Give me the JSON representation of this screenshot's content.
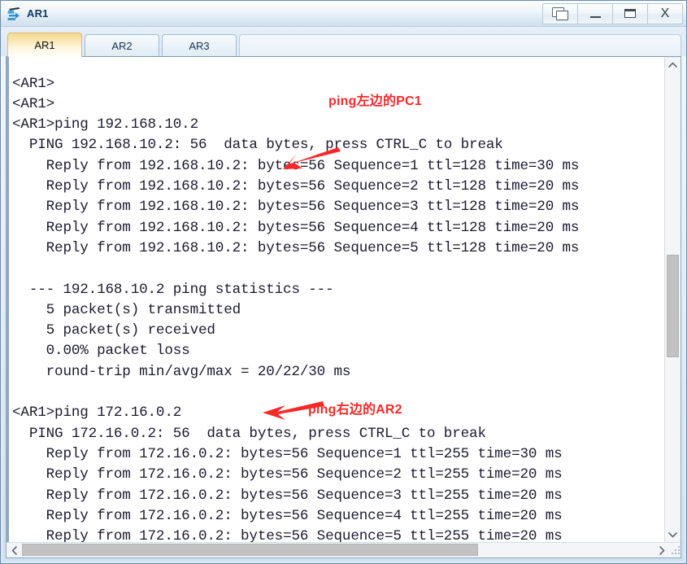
{
  "window": {
    "title": "AR1",
    "icon": "router-icon",
    "controls": [
      {
        "name": "restore-button",
        "label": "",
        "icon": "restore-windows-icon"
      },
      {
        "name": "minimize-button",
        "label": "",
        "icon": "minimize-icon"
      },
      {
        "name": "maximize-button",
        "label": "",
        "icon": "maximize-icon"
      },
      {
        "name": "close-button",
        "label": "X",
        "icon": "close-icon"
      }
    ]
  },
  "tabs": [
    {
      "label": "AR1",
      "active": true
    },
    {
      "label": "AR2",
      "active": false
    },
    {
      "label": "AR3",
      "active": false
    }
  ],
  "console": {
    "lines": [
      "<AR1>",
      "<AR1>",
      "<AR1>ping 192.168.10.2",
      "  PING 192.168.10.2: 56  data bytes, press CTRL_C to break",
      "    Reply from 192.168.10.2: bytes=56 Sequence=1 ttl=128 time=30 ms",
      "    Reply from 192.168.10.2: bytes=56 Sequence=2 ttl=128 time=20 ms",
      "    Reply from 192.168.10.2: bytes=56 Sequence=3 ttl=128 time=20 ms",
      "    Reply from 192.168.10.2: bytes=56 Sequence=4 ttl=128 time=20 ms",
      "    Reply from 192.168.10.2: bytes=56 Sequence=5 ttl=128 time=20 ms",
      "",
      "  --- 192.168.10.2 ping statistics ---",
      "    5 packet(s) transmitted",
      "    5 packet(s) received",
      "    0.00% packet loss",
      "    round-trip min/avg/max = 20/22/30 ms",
      "",
      "<AR1>ping 172.16.0.2",
      "  PING 172.16.0.2: 56  data bytes, press CTRL_C to break",
      "    Reply from 172.16.0.2: bytes=56 Sequence=1 ttl=255 time=30 ms",
      "    Reply from 172.16.0.2: bytes=56 Sequence=2 ttl=255 time=20 ms",
      "    Reply from 172.16.0.2: bytes=56 Sequence=3 ttl=255 time=20 ms",
      "    Reply from 172.16.0.2: bytes=56 Sequence=4 ttl=255 time=20 ms",
      "    Reply from 172.16.0.2: bytes=56 Sequence=5 ttl=255 time=20 ms"
    ]
  },
  "annotations": [
    {
      "text": "ping左边的PC1",
      "color": "#fb2828",
      "target": "ping-192-168-10-2-command"
    },
    {
      "text": "ping右边的AR2",
      "color": "#fb2828",
      "target": "ping-172-16-0-2-command"
    }
  ],
  "scrollbars": {
    "vertical": {
      "up_arrow": "⌃",
      "down_arrow": "⌄"
    },
    "horizontal": {
      "left_arrow": "‹",
      "right_arrow": "›"
    }
  }
}
